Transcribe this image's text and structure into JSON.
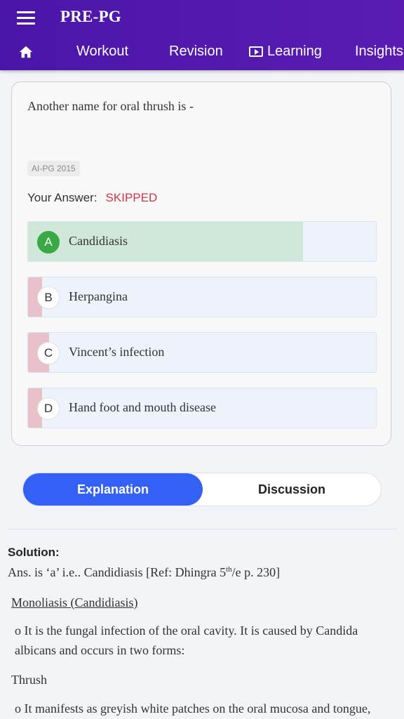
{
  "header": {
    "title": "PRE-PG",
    "menu_icon": "hamburger-menu-icon"
  },
  "nav": {
    "home_icon": "home-icon",
    "items": [
      {
        "label": "Workout"
      },
      {
        "label": "Revision"
      },
      {
        "label": "Learning",
        "icon": "play-screen-icon"
      },
      {
        "label": "Insights"
      }
    ]
  },
  "question": {
    "text": "Another name for oral thrush is -",
    "tag": "AI-PG 2015",
    "your_answer_label": "Your Answer:",
    "your_answer_status": "SKIPPED"
  },
  "options": [
    {
      "letter": "A",
      "text": "Candidiasis",
      "correct": true,
      "percent": 79
    },
    {
      "letter": "B",
      "text": "Herpangina",
      "correct": false,
      "percent": 4
    },
    {
      "letter": "C",
      "text": "Vincent’s infection",
      "correct": false,
      "percent": 6
    },
    {
      "letter": "D",
      "text": "Hand foot and mouth disease",
      "correct": false,
      "percent": 4
    }
  ],
  "tabs": {
    "explanation": "Explanation",
    "discussion": "Discussion"
  },
  "solution": {
    "heading": "Solution:",
    "answer_prefix": "Ans. is ‘a’ i.e.. Candidiasis [Ref: Dhingra 5",
    "answer_sup": "th",
    "answer_suffix": "/e p. 230]",
    "subheading": "Monoliasis (Candidiasis)",
    "para1": "o It is the fungal infection of the oral cavity. It is caused by Candida albicans and occurs in two forms:",
    "thrush": "Thrush",
    "para2": "o It manifests as greyish white patches on the oral mucosa and tongue,"
  },
  "colors": {
    "header_bg": "#4a16a8",
    "tab_active": "#3361f6",
    "correct_fill": "#d0e8d9",
    "wrong_fill": "#e8c1cb",
    "skipped_text": "#d0364a",
    "correct_badge": "#3aa845"
  }
}
